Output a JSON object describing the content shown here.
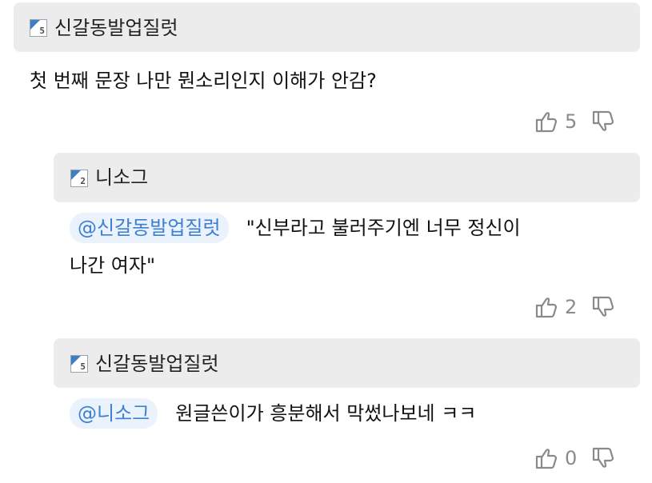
{
  "comments": [
    {
      "level": "5",
      "nickname": "신갈동발업질럿",
      "mention": "",
      "body": "첫 번째 문장 나만 뭔소리인지 이해가 안감?",
      "likes": "5"
    },
    {
      "level": "2",
      "nickname": "니소그",
      "mention": "@신갈동발업질럿",
      "body_line1": "\"신부라고 불러주기엔 너무 정신이",
      "body_line2": "나간 여자\"",
      "likes": "2"
    },
    {
      "level": "5",
      "nickname": "신갈동발업질럿",
      "mention": "@니소그",
      "body": "원글쓴이가 흥분해서 막썼나보네 ㅋㅋ",
      "likes": "0"
    }
  ],
  "icons": {
    "like": "thumbs-up-icon",
    "dislike": "thumbs-down-icon",
    "level": "level-badge-icon"
  }
}
